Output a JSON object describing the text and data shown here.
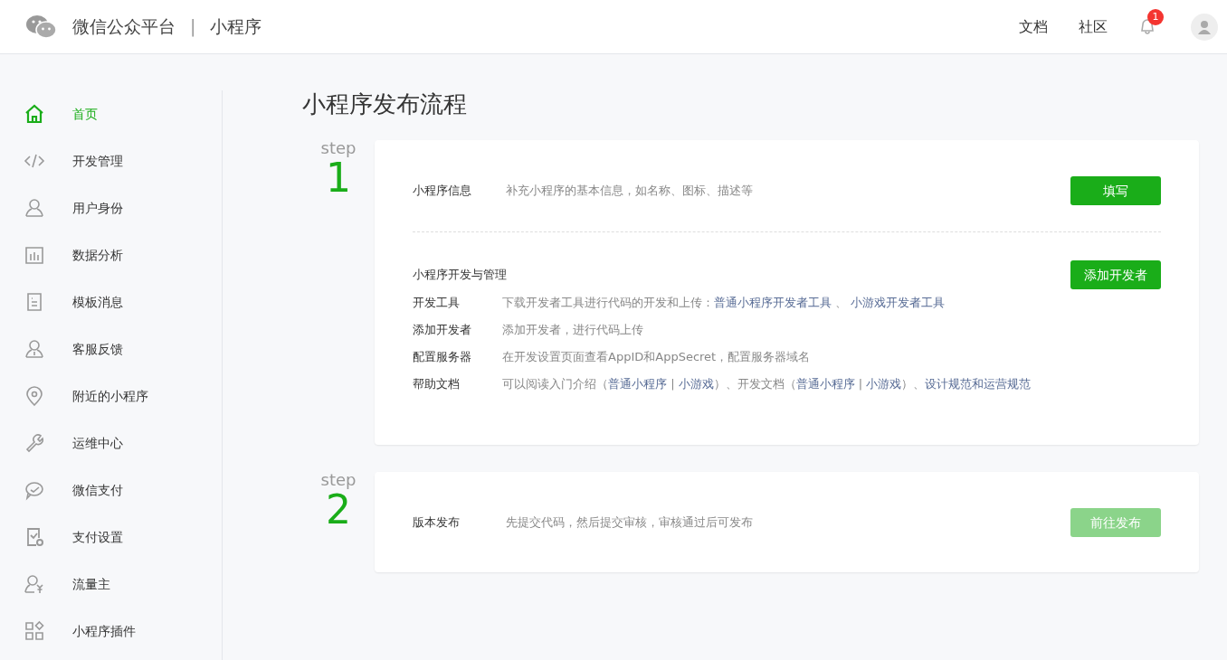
{
  "header": {
    "brand": "微信公众平台",
    "separator": "|",
    "product": "小程序",
    "links": [
      "文档",
      "社区"
    ],
    "notification_count": "1"
  },
  "sidebar": {
    "items": [
      {
        "label": "首页",
        "selected": true
      },
      {
        "label": "开发管理",
        "selected": false
      },
      {
        "label": "用户身份",
        "selected": false
      },
      {
        "label": "数据分析",
        "selected": false
      },
      {
        "label": "模板消息",
        "selected": false
      },
      {
        "label": "客服反馈",
        "selected": false
      },
      {
        "label": "附近的小程序",
        "selected": false
      },
      {
        "label": "运维中心",
        "selected": false
      },
      {
        "label": "微信支付",
        "selected": false
      },
      {
        "label": "支付设置",
        "selected": false
      },
      {
        "label": "流量主",
        "selected": false
      },
      {
        "label": "小程序插件",
        "selected": false
      }
    ]
  },
  "page_title": "小程序发布流程",
  "steps": [
    {
      "step_label": "step",
      "number": "1",
      "sections": [
        {
          "kind": "simple",
          "label": "小程序信息",
          "description": "补充小程序的基本信息，如名称、图标、描述等",
          "button": {
            "label": "填写",
            "disabled": false
          }
        },
        {
          "kind": "list",
          "title": "小程序开发与管理",
          "button": {
            "label": "添加开发者",
            "disabled": false
          },
          "rows": [
            {
              "label": "开发工具",
              "parts": [
                {
                  "kind": "text",
                  "text": "下载开发者工具进行代码的开发和上传："
                },
                {
                  "kind": "link",
                  "text": "普通小程序开发者工具"
                },
                {
                  "kind": "text",
                  "text": " 、 "
                },
                {
                  "kind": "link",
                  "text": "小游戏开发者工具"
                }
              ]
            },
            {
              "label": "添加开发者",
              "parts": [
                {
                  "kind": "text",
                  "text": "添加开发者，进行代码上传"
                }
              ]
            },
            {
              "label": "配置服务器",
              "parts": [
                {
                  "kind": "text",
                  "text": "在开发设置页面查看AppID和AppSecret，配置服务器域名"
                }
              ]
            },
            {
              "label": "帮助文档",
              "parts": [
                {
                  "kind": "text",
                  "text": "可以阅读入门介绍（"
                },
                {
                  "kind": "link",
                  "text": "普通小程序"
                },
                {
                  "kind": "text",
                  "text": " | "
                },
                {
                  "kind": "link",
                  "text": "小游戏"
                },
                {
                  "kind": "text",
                  "text": "）、开发文档（"
                },
                {
                  "kind": "link",
                  "text": "普通小程序"
                },
                {
                  "kind": "text",
                  "text": " | "
                },
                {
                  "kind": "link",
                  "text": "小游戏"
                },
                {
                  "kind": "text",
                  "text": "）、"
                },
                {
                  "kind": "link",
                  "text": "设计规范和运营规范"
                }
              ]
            }
          ]
        }
      ]
    },
    {
      "step_label": "step",
      "number": "2",
      "sections": [
        {
          "kind": "simple",
          "label": "版本发布",
          "description": "先提交代码，然后提交审核，审核通过后可发布",
          "button": {
            "label": "前往发布",
            "disabled": true
          }
        }
      ]
    }
  ]
}
